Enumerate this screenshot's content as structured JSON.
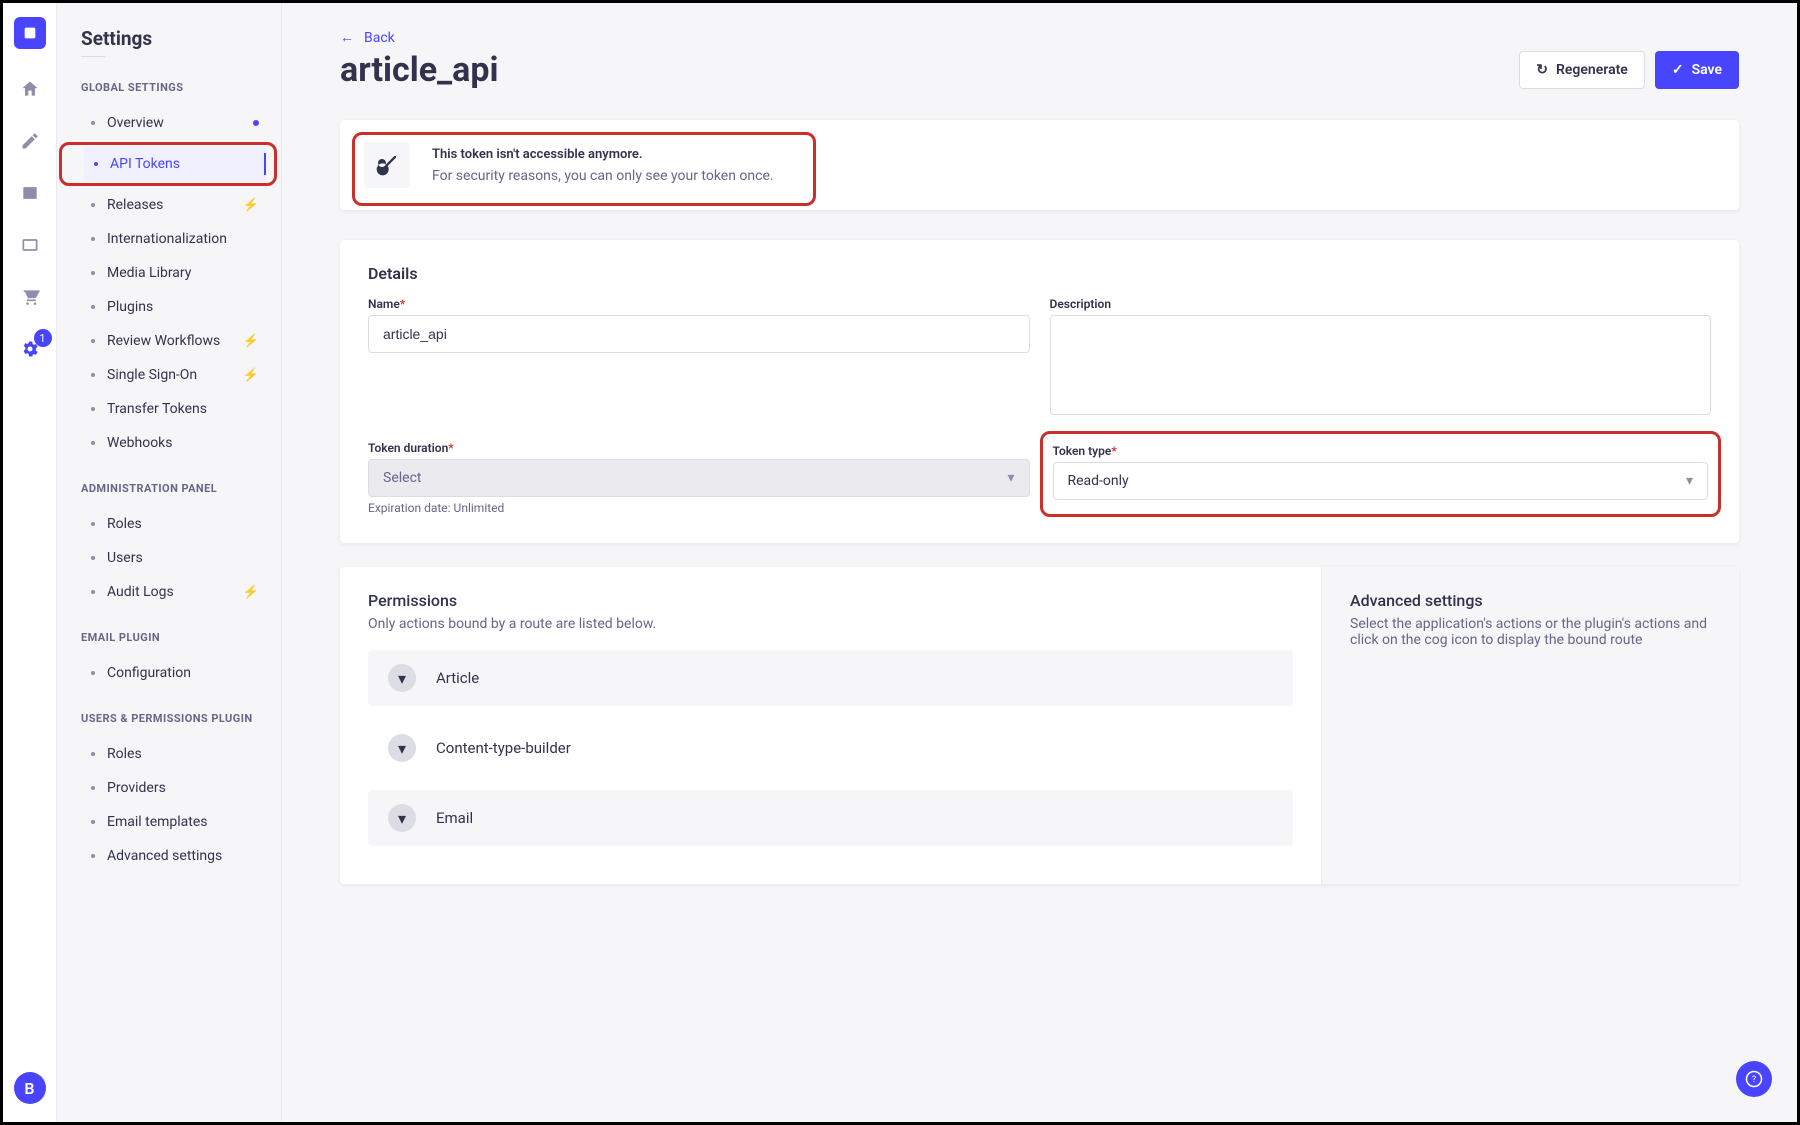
{
  "rail": {
    "badge_count": "1",
    "avatar_letter": "B"
  },
  "sidebar": {
    "title": "Settings",
    "sections": {
      "global": {
        "label": "GLOBAL SETTINGS",
        "items": [
          {
            "label": "Overview"
          },
          {
            "label": "API Tokens"
          },
          {
            "label": "Releases"
          },
          {
            "label": "Internationalization"
          },
          {
            "label": "Media Library"
          },
          {
            "label": "Plugins"
          },
          {
            "label": "Review Workflows"
          },
          {
            "label": "Single Sign-On"
          },
          {
            "label": "Transfer Tokens"
          },
          {
            "label": "Webhooks"
          }
        ]
      },
      "admin": {
        "label": "ADMINISTRATION PANEL",
        "items": [
          {
            "label": "Roles"
          },
          {
            "label": "Users"
          },
          {
            "label": "Audit Logs"
          }
        ]
      },
      "email": {
        "label": "EMAIL PLUGIN",
        "items": [
          {
            "label": "Configuration"
          }
        ]
      },
      "upp": {
        "label": "USERS & PERMISSIONS PLUGIN",
        "items": [
          {
            "label": "Roles"
          },
          {
            "label": "Providers"
          },
          {
            "label": "Email templates"
          },
          {
            "label": "Advanced settings"
          }
        ]
      }
    }
  },
  "back_label": "Back",
  "page_title": "article_api",
  "actions": {
    "regenerate": "Regenerate",
    "save": "Save"
  },
  "warning": {
    "title": "This token isn't accessible anymore.",
    "subtitle": "For security reasons, you can only see your token once."
  },
  "details": {
    "heading": "Details",
    "name_label": "Name",
    "name_value": "article_api",
    "desc_label": "Description",
    "desc_value": "",
    "duration_label": "Token duration",
    "duration_value": "Select",
    "duration_helper": "Expiration date: Unlimited",
    "type_label": "Token type",
    "type_value": "Read-only"
  },
  "permissions": {
    "heading": "Permissions",
    "subtitle": "Only actions bound by a route are listed below.",
    "items": [
      {
        "label": "Article"
      },
      {
        "label": "Content-type-builder"
      },
      {
        "label": "Email"
      }
    ]
  },
  "advanced": {
    "heading": "Advanced settings",
    "subtitle": "Select the application's actions or the plugin's actions and click on the cog icon to display the bound route"
  }
}
